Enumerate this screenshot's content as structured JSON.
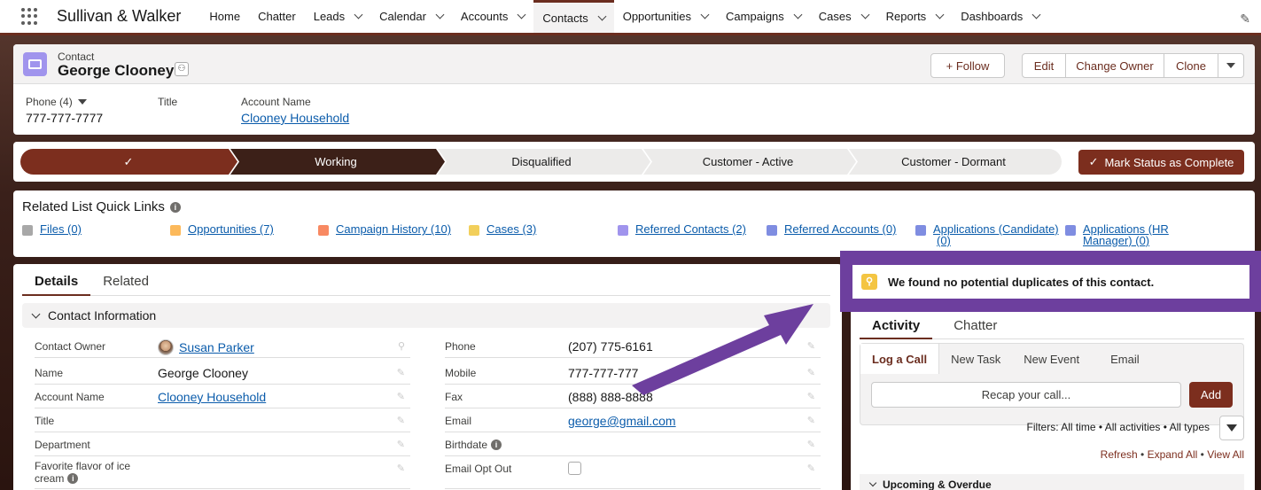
{
  "nav": {
    "app_name": "Sullivan & Walker",
    "items": [
      {
        "label": "Home",
        "dropdown": false
      },
      {
        "label": "Chatter",
        "dropdown": false
      },
      {
        "label": "Leads",
        "dropdown": true
      },
      {
        "label": "Calendar",
        "dropdown": true
      },
      {
        "label": "Accounts",
        "dropdown": true
      },
      {
        "label": "Contacts",
        "dropdown": true,
        "active": true
      },
      {
        "label": "Opportunities",
        "dropdown": true
      },
      {
        "label": "Campaigns",
        "dropdown": true
      },
      {
        "label": "Cases",
        "dropdown": true
      },
      {
        "label": "Reports",
        "dropdown": true
      },
      {
        "label": "Dashboards",
        "dropdown": true
      }
    ]
  },
  "record": {
    "object_type": "Contact",
    "name": "George Clooney",
    "actions": {
      "follow": "+ Follow",
      "edit": "Edit",
      "change_owner": "Change Owner",
      "clone": "Clone"
    },
    "highlights": {
      "phone_label": "Phone (4)",
      "phone_value": "777-777-7777",
      "title_label": "Title",
      "account_label": "Account Name",
      "account_value": "Clooney Household"
    }
  },
  "path": {
    "steps": [
      "✓",
      "Working",
      "Disqualified",
      "Customer - Active",
      "Customer - Dormant"
    ],
    "mark_button": "Mark Status as Complete"
  },
  "quick_links": {
    "title": "Related List Quick Links",
    "links": [
      {
        "label": "Files (0)",
        "color": "#a8a8a8"
      },
      {
        "label": "Opportunities (7)",
        "color": "#fcb95b"
      },
      {
        "label": "Campaign History (10)",
        "color": "#f88962"
      },
      {
        "label": "Cases (3)",
        "color": "#f2cf5b"
      },
      {
        "label": "Referred Contacts (2)",
        "color": "#a094ed"
      },
      {
        "label": "Referred Accounts (0)",
        "color": "#7f8de1"
      },
      {
        "label": "Applications (Candidate)",
        "label2": "(0)",
        "color": "#7f8de1"
      },
      {
        "label": "Applications (HR",
        "label2": "Manager) (0)",
        "color": "#7f8de1"
      }
    ]
  },
  "details": {
    "tabs": [
      "Details",
      "Related"
    ],
    "section_title": "Contact Information",
    "left_fields": [
      {
        "label": "Contact Owner",
        "value": "Susan Parker"
      },
      {
        "label": "Name",
        "value": "George Clooney"
      },
      {
        "label": "Account Name",
        "value": "Clooney Household"
      },
      {
        "label": "Title",
        "value": ""
      },
      {
        "label": "Department",
        "value": ""
      },
      {
        "label": "Favorite flavor of ice",
        "label2": "cream",
        "value": ""
      }
    ],
    "right_fields": [
      {
        "label": "Phone",
        "value": "(207) 775-6161"
      },
      {
        "label": "Mobile",
        "value": "777-777-777"
      },
      {
        "label": "Fax",
        "value": "(888) 888-8888"
      },
      {
        "label": "Email",
        "value": "george@gmail.com"
      },
      {
        "label": "Birthdate",
        "value": ""
      },
      {
        "label": "Email Opt Out",
        "value": ""
      }
    ]
  },
  "duplicates": {
    "message": "We found no potential duplicates of this contact.",
    "highlight_color": "#6d3f9e"
  },
  "activity": {
    "tabs": [
      "Activity",
      "Chatter"
    ],
    "publisher_tabs": [
      "Log a Call",
      "New Task",
      "New Event",
      "Email"
    ],
    "recap_placeholder": "Recap your call...",
    "add_label": "Add",
    "filters_text": "Filters: All time • All activities • All types",
    "links": [
      "Refresh",
      "Expand All",
      "View All"
    ],
    "upcoming": "Upcoming & Overdue"
  },
  "colors": {
    "brand": "#6b2d1f",
    "button": "#7c2e1e",
    "link": "#0b5cab",
    "annotation_arrow": "#6d3f9e"
  }
}
